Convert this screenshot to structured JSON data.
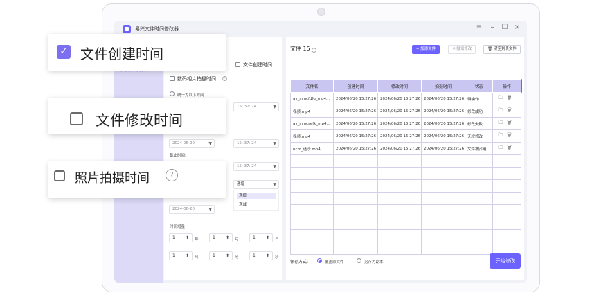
{
  "app": {
    "title": "易兴文件时间修改器"
  },
  "window_controls": [
    "≡",
    "–",
    "☐",
    "×"
  ],
  "sidebar": {
    "items": [
      {
        "label": "文件夹时间"
      }
    ]
  },
  "settings": {
    "file_created_label": "文件创建时间",
    "digital_photo_label": "数码相片拍摄时间",
    "uniform_time_label": "统一为以下时间",
    "start_date": "2024-06-20",
    "start_time": "15: 37: 24",
    "start_time2": "15: 37: 24",
    "end_date_label": "截止时间:",
    "end_time": "15: 37: 24",
    "mode_select": "递增",
    "mode_options": [
      "递增",
      "递减"
    ],
    "date_value": "2024-06-20",
    "increment_label": "时间增量",
    "units": [
      {
        "value": "1",
        "unit": "年"
      },
      {
        "value": "1",
        "unit": "月"
      },
      {
        "value": "1",
        "unit": "日"
      },
      {
        "value": "1",
        "unit": "时"
      },
      {
        "value": "1",
        "unit": "分"
      },
      {
        "value": "1",
        "unit": "秒"
      }
    ]
  },
  "main": {
    "file_count_label": "文件 15",
    "add_file": "加添文件",
    "undo": "撤销修改",
    "clear_list": "清空列表文件",
    "columns": [
      "文件名",
      "创建时间",
      "修改时间",
      "拍摄时间",
      "状态",
      "操作"
    ],
    "rows": [
      {
        "name": "av_syncfdfg_mp4...",
        "created": "2024/06/20 15:27:26",
        "modified": "2024/06/20 15:27:26",
        "shot": "2024/06/20 15:27:26",
        "status": "待操作"
      },
      {
        "name": "视频.mp4",
        "created": "2024/06/20 15:27:26",
        "modified": "2024/06/20 15:27:26",
        "shot": "2024/06/20 15:27:26",
        "status": "修改成功"
      },
      {
        "name": "av_syncsefk_mp4...",
        "created": "2024/06/20 15:27:26",
        "modified": "2024/06/20 15:27:26",
        "shot": "2024/06/20 15:27:26",
        "status": "修改失败"
      },
      {
        "name": "视频.mp4",
        "created": "2024/06/20 15:27:26",
        "modified": "2024/06/20 15:27:26",
        "shot": "2024/06/20 15:27:26",
        "status": "无权修改"
      },
      {
        "name": "ncm_迷沙.mp4",
        "created": "2024/06/20 15:27:26",
        "modified": "2024/06/20 15:27:26",
        "shot": "2024/06/20 15:27:26",
        "status": "文件被占用"
      }
    ],
    "empty_row_count": 8,
    "save_mode_label": "保存方式:",
    "save_overwrite": "覆盖原文件",
    "save_copy": "另存为副本",
    "start_button": "开始修改"
  },
  "callouts": {
    "file_created": "文件创建时间",
    "file_modified": "文件修改时间",
    "photo_taken": "照片拍摄时间"
  },
  "colors": {
    "accent": "#6c63ff",
    "sidebar": "#dcdaf6",
    "table_header": "#c9c6f2"
  }
}
